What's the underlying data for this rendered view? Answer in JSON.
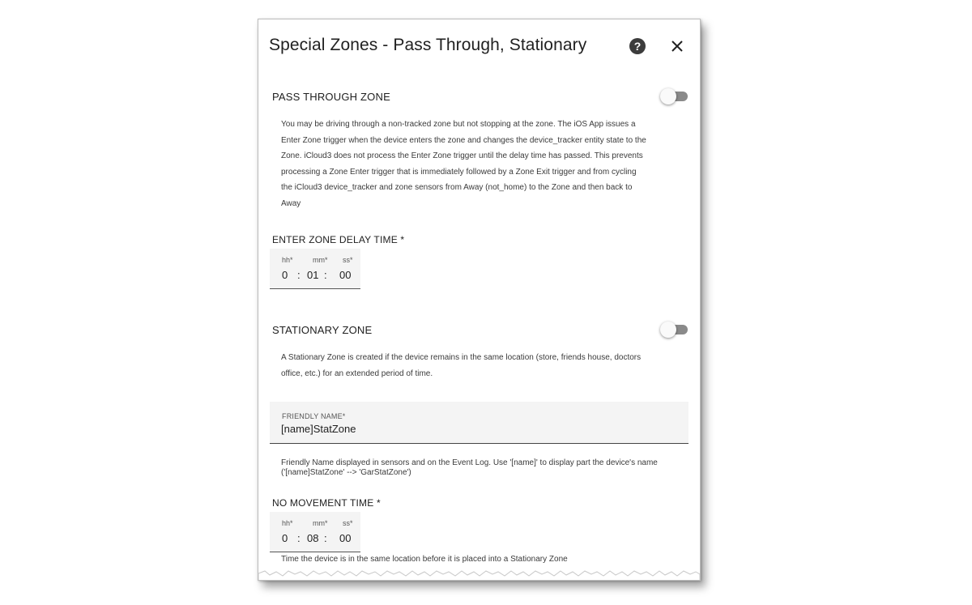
{
  "dialog": {
    "title": "Special Zones - Pass Through, Stationary",
    "help_icon": "help-circle-icon",
    "close_icon": "close-icon"
  },
  "pass_through": {
    "label": "PASS THROUGH ZONE",
    "toggle_on": false,
    "description_lines": [
      "You may be driving through a non-tracked zone but not stopping at the zone. The iOS App issues a",
      "Enter Zone trigger when the device enters the zone and changes the device_tracker entity state to the",
      "Zone. iCloud3 does not process the Enter Zone trigger until the delay time has passed. This prevents",
      "processing a Zone Enter trigger that is immediately followed by a Zone Exit trigger and from cycling",
      "the iCloud3 device_tracker and zone sensors from Away (not_home) to the Zone and then back to",
      "Away"
    ],
    "delay_label": "ENTER ZONE DELAY TIME *",
    "delay": {
      "hh_label": "hh*",
      "mm_label": "mm*",
      "ss_label": "ss*",
      "hh": "0",
      "mm": "01",
      "ss": "00",
      "sep": ":"
    }
  },
  "stationary": {
    "label": "STATIONARY ZONE",
    "toggle_on": false,
    "description_lines": [
      "A Stationary Zone is created if the device remains in the same location (store, friends house, doctors",
      "office, etc.) for an extended period of time."
    ],
    "friendly_name_label": "FRIENDLY NAME*",
    "friendly_name_value": "[name]StatZone",
    "friendly_name_help_lines": [
      "Friendly Name displayed in sensors and on the Event Log. Use '[name]' to display part the device's name",
      "('[name]StatZone' --> 'GarStatZone')"
    ],
    "no_movement_label": "NO MOVEMENT TIME *",
    "no_movement": {
      "hh_label": "hh*",
      "mm_label": "mm*",
      "ss_label": "ss*",
      "hh": "0",
      "mm": "08",
      "ss": "00",
      "sep": ":"
    },
    "no_movement_help": "Time the device is in the same location before it is placed into a Stationary Zone"
  }
}
